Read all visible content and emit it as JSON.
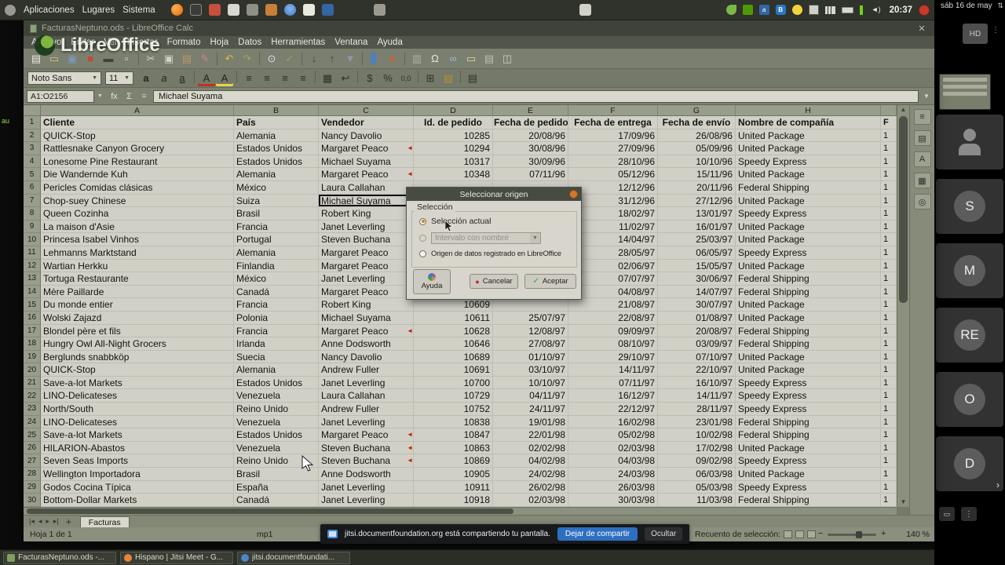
{
  "panel": {
    "menus": [
      "Aplicaciones",
      "Lugares",
      "Sistema"
    ],
    "launchers": [
      {
        "n": "firefox"
      },
      {
        "n": "terminal"
      },
      {
        "n": "mail"
      },
      {
        "n": "editor"
      },
      {
        "n": "files"
      },
      {
        "n": "music"
      },
      {
        "n": "chromium"
      },
      {
        "n": "document"
      },
      {
        "n": "maxima"
      },
      {
        "n": "screenshot"
      },
      {
        "n": "windowlist"
      }
    ],
    "tray": [
      {
        "n": "messaging",
        "cls": "tr-leaf"
      },
      {
        "n": "sync",
        "cls": "tr-box"
      },
      {
        "n": "input-method",
        "cls": "tr-app",
        "g": "a"
      },
      {
        "n": "bluetooth",
        "cls": "tr-bt",
        "g": "B"
      },
      {
        "n": "updates",
        "cls": "tr-update"
      },
      {
        "n": "display",
        "cls": "tr-display"
      },
      {
        "n": "network-signal",
        "cls": "tr-signal"
      },
      {
        "n": "battery",
        "cls": "tr-batt"
      },
      {
        "n": "power-indicator",
        "cls": "tr-ind"
      },
      {
        "n": "volume",
        "cls": "tr-vol",
        "g": "◄)"
      }
    ],
    "clock": "20:37"
  },
  "desktop": {
    "icon_label": "au"
  },
  "window": {
    "title": "FacturasNeptuno.ods - LibreOffice Calc"
  },
  "watermark": {
    "text": "LibreOffice"
  },
  "menubar": {
    "items": [
      "Archivo",
      "Editar",
      "Ver",
      "Insertar",
      "Formato",
      "Hoja",
      "Datos",
      "Herramientas",
      "Ventana",
      "Ayuda"
    ]
  },
  "toolbar_main": [
    {
      "n": "new",
      "g": "▤",
      "c": "#e8e8dc"
    },
    {
      "n": "open",
      "g": "▭",
      "c": "#d9c27e"
    },
    {
      "n": "save",
      "g": "▣",
      "c": "#7e96bb"
    },
    {
      "n": "export-pdf",
      "g": "■",
      "c": "#bf4a3a"
    },
    {
      "n": "print",
      "g": "▬",
      "c": "#3f443c"
    },
    {
      "n": "print-preview",
      "g": "▫",
      "c": "#dfe3d8"
    },
    {
      "sep": true
    },
    {
      "n": "cut",
      "g": "✂",
      "c": "#d6d6cb"
    },
    {
      "n": "copy",
      "g": "▣",
      "c": "#cfd2c5"
    },
    {
      "n": "paste",
      "g": "▤",
      "c": "#bb9a64"
    },
    {
      "n": "clone-formatting",
      "g": "✎",
      "c": "#cb8490"
    },
    {
      "sep": true
    },
    {
      "n": "undo",
      "g": "↶",
      "c": "#e6bb3e"
    },
    {
      "n": "redo",
      "g": "↷",
      "c": "#8cb64e"
    },
    {
      "sep": true
    },
    {
      "n": "find-replace",
      "g": "⊙",
      "c": "#d7dfe8"
    },
    {
      "n": "spelling",
      "g": "✓",
      "c": "#86b25c"
    },
    {
      "sep": true
    },
    {
      "n": "sort-ascending",
      "g": "↓",
      "c": "#3e423a"
    },
    {
      "n": "sort-descending",
      "g": "↑",
      "c": "#3e423a"
    },
    {
      "n": "autofilter",
      "g": "▼",
      "c": "#8e98ab"
    },
    {
      "sep": true
    },
    {
      "n": "insert-chart",
      "g": "▊",
      "c": "#5280b4"
    },
    {
      "n": "insert-image",
      "g": "●",
      "c": "#dd5a2a"
    },
    {
      "sep": true
    },
    {
      "n": "freeze-rows-columns",
      "g": "▥",
      "c": "#aeb6a2"
    },
    {
      "n": "special-character",
      "g": "Ω",
      "c": "#e8e8dd"
    },
    {
      "n": "hyperlink",
      "g": "∞",
      "c": "#9ab8d6"
    },
    {
      "n": "comment",
      "g": "▭",
      "c": "#e5dc96"
    },
    {
      "n": "headers-footers",
      "g": "▤",
      "c": "#b9c2b4"
    },
    {
      "n": "sidebar-toggle",
      "g": "◫",
      "c": "#ccd4c6"
    }
  ],
  "toolbar_format": {
    "font_name": "Noto Sans",
    "font_size": "11",
    "icons": [
      {
        "n": "bold",
        "g": "a",
        "cls": "fb"
      },
      {
        "n": "italic",
        "g": "a",
        "cls": "fi"
      },
      {
        "n": "underline",
        "g": "a",
        "cls": "fu"
      },
      {
        "sep": true
      },
      {
        "n": "font-color",
        "g": "A",
        "cls": "fc"
      },
      {
        "n": "highlight-color",
        "g": "A",
        "cls": "fh"
      },
      {
        "sep": true
      },
      {
        "n": "align-left",
        "g": "≡",
        "cls": "al"
      },
      {
        "n": "align-center",
        "g": "≡",
        "cls": "al"
      },
      {
        "n": "align-right",
        "g": "≡",
        "cls": "al"
      },
      {
        "n": "justify",
        "g": "≡",
        "cls": "al"
      },
      {
        "sep": true
      },
      {
        "n": "merge-cells",
        "g": "▦",
        "c": "#2e3228"
      },
      {
        "n": "wrap-text",
        "g": "↩",
        "c": "#2e3228"
      },
      {
        "sep": true
      },
      {
        "n": "format-currency",
        "g": "$",
        "c": "#2e3228"
      },
      {
        "n": "format-percent",
        "g": "%",
        "c": "#2e3228"
      },
      {
        "n": "format-number",
        "g": "0,0",
        "c": "#2e3228"
      },
      {
        "sep": true
      },
      {
        "n": "borders",
        "g": "⊞",
        "c": "#2e3228"
      },
      {
        "n": "background-color",
        "g": "▨",
        "c": "#b58a3c"
      },
      {
        "sep": true
      },
      {
        "n": "conditional-formatting",
        "g": "▤",
        "c": "#2e3228"
      }
    ]
  },
  "formula_bar": {
    "name_box": "A1:O2156",
    "fx_label": "fx",
    "sum_label": "Σ",
    "equals_label": "=",
    "content": "Michael Suyama"
  },
  "grid": {
    "col_letters": [
      "A",
      "B",
      "C",
      "D",
      "E",
      "F",
      "G",
      "H"
    ],
    "rows": [
      {
        "n": "1",
        "h": true,
        "c": [
          "Cliente",
          "País",
          "Vendedor",
          "Id. de pedido",
          "Fecha de pedido",
          "Fecha de entrega",
          "Fecha de envío",
          "Nombre de compañía",
          "F"
        ]
      },
      {
        "n": "2",
        "c": [
          "QUICK-Stop",
          "Alemania",
          "Nancy Davolio",
          "10285",
          "20/08/96",
          "17/09/96",
          "26/08/96",
          "United Package",
          "1"
        ]
      },
      {
        "n": "3",
        "t": 1,
        "c": [
          "Rattlesnake Canyon Grocery",
          "Estados Unidos",
          "Margaret Peaco",
          "10294",
          "30/08/96",
          "27/09/96",
          "05/09/96",
          "United Package",
          "1"
        ]
      },
      {
        "n": "4",
        "c": [
          "Lonesome Pine Restaurant",
          "Estados Unidos",
          "Michael Suyama",
          "10317",
          "30/09/96",
          "28/10/96",
          "10/10/96",
          "Speedy Express",
          "1"
        ]
      },
      {
        "n": "5",
        "t": 1,
        "c": [
          "Die Wandernde Kuh",
          "Alemania",
          "Margaret Peaco",
          "10348",
          "07/11/96",
          "05/12/96",
          "15/11/96",
          "United Package",
          "1"
        ]
      },
      {
        "n": "6",
        "c": [
          "Pericles Comidas clásicas",
          "México",
          "Laura Callahan",
          "",
          "",
          "12/12/96",
          "20/11/96",
          "Federal Shipping",
          "1"
        ]
      },
      {
        "n": "7",
        "a": 1,
        "c": [
          "Chop-suey Chinese",
          "Suiza",
          "Michael Suyama",
          "",
          "",
          "31/12/96",
          "27/12/96",
          "United Package",
          "1"
        ]
      },
      {
        "n": "8",
        "c": [
          "Queen Cozinha",
          "Brasil",
          "Robert King",
          "",
          "",
          "18/02/97",
          "13/01/97",
          "Speedy Express",
          "1"
        ]
      },
      {
        "n": "9",
        "c": [
          "La maison d'Asie",
          "Francia",
          "Janet Leverling",
          "",
          "",
          "11/02/97",
          "16/01/97",
          "United Package",
          "1"
        ]
      },
      {
        "n": "10",
        "t": 1,
        "c": [
          "Princesa Isabel Vinhos",
          "Portugal",
          "Steven Buchana",
          "",
          "",
          "14/04/97",
          "25/03/97",
          "United Package",
          "1"
        ]
      },
      {
        "n": "11",
        "t": 1,
        "c": [
          "Lehmanns Marktstand",
          "Alemania",
          "Margaret Peaco",
          "",
          "",
          "28/05/97",
          "06/05/97",
          "Speedy Express",
          "1"
        ]
      },
      {
        "n": "12",
        "t": 1,
        "c": [
          "Wartian Herkku",
          "Finlandia",
          "Margaret Peaco",
          "",
          "",
          "02/06/97",
          "15/05/97",
          "United Package",
          "1"
        ]
      },
      {
        "n": "13",
        "c": [
          "Tortuga Restaurante",
          "México",
          "Janet Leverling",
          "",
          "",
          "07/07/97",
          "30/06/97",
          "Federal Shipping",
          "1"
        ]
      },
      {
        "n": "14",
        "t": 1,
        "c": [
          "Mère Paillarde",
          "Canadá",
          "Margaret Peaco",
          "",
          "",
          "04/08/97",
          "14/07/97",
          "Federal Shipping",
          "1"
        ]
      },
      {
        "n": "15",
        "c": [
          "Du monde entier",
          "Francia",
          "Robert King",
          "10609",
          "",
          "21/08/97",
          "30/07/97",
          "United Package",
          "1"
        ]
      },
      {
        "n": "16",
        "c": [
          "Wolski Zajazd",
          "Polonia",
          "Michael Suyama",
          "10611",
          "25/07/97",
          "22/08/97",
          "01/08/97",
          "United Package",
          "1"
        ]
      },
      {
        "n": "17",
        "t": 1,
        "c": [
          "Blondel père et fils",
          "Francia",
          "Margaret Peaco",
          "10628",
          "12/08/97",
          "09/09/97",
          "20/08/97",
          "Federal Shipping",
          "1"
        ]
      },
      {
        "n": "18",
        "c": [
          "Hungry Owl All-Night Grocers",
          "Irlanda",
          "Anne Dodsworth",
          "10646",
          "27/08/97",
          "08/10/97",
          "03/09/97",
          "Federal Shipping",
          "1"
        ]
      },
      {
        "n": "19",
        "c": [
          "Berglunds snabbköp",
          "Suecia",
          "Nancy Davolio",
          "10689",
          "01/10/97",
          "29/10/97",
          "07/10/97",
          "United Package",
          "1"
        ]
      },
      {
        "n": "20",
        "c": [
          "QUICK-Stop",
          "Alemania",
          "Andrew Fuller",
          "10691",
          "03/10/97",
          "14/11/97",
          "22/10/97",
          "United Package",
          "1"
        ]
      },
      {
        "n": "21",
        "c": [
          "Save-a-lot Markets",
          "Estados Unidos",
          "Janet Leverling",
          "10700",
          "10/10/97",
          "07/11/97",
          "16/10/97",
          "Speedy Express",
          "1"
        ]
      },
      {
        "n": "22",
        "c": [
          "LINO-Delicateses",
          "Venezuela",
          "Laura Callahan",
          "10729",
          "04/11/97",
          "16/12/97",
          "14/11/97",
          "Speedy Express",
          "1"
        ]
      },
      {
        "n": "23",
        "c": [
          "North/South",
          "Reino Unido",
          "Andrew Fuller",
          "10752",
          "24/11/97",
          "22/12/97",
          "28/11/97",
          "Speedy Express",
          "1"
        ]
      },
      {
        "n": "24",
        "c": [
          "LINO-Delicateses",
          "Venezuela",
          "Janet Leverling",
          "10838",
          "19/01/98",
          "16/02/98",
          "23/01/98",
          "Federal Shipping",
          "1"
        ]
      },
      {
        "n": "25",
        "t": 1,
        "c": [
          "Save-a-lot Markets",
          "Estados Unidos",
          "Margaret Peaco",
          "10847",
          "22/01/98",
          "05/02/98",
          "10/02/98",
          "Federal Shipping",
          "1"
        ]
      },
      {
        "n": "26",
        "t": 1,
        "c": [
          "HILARION-Abastos",
          "Venezuela",
          "Steven Buchana",
          "10863",
          "02/02/98",
          "02/03/98",
          "17/02/98",
          "United Package",
          "1"
        ]
      },
      {
        "n": "27",
        "t": 1,
        "c": [
          "Seven Seas Imports",
          "Reino Unido",
          "Steven Buchana",
          "10869",
          "04/02/98",
          "04/03/98",
          "09/02/98",
          "Speedy Express",
          "1"
        ]
      },
      {
        "n": "28",
        "c": [
          "Wellington Importadora",
          "Brasil",
          "Anne Dodsworth",
          "10905",
          "24/02/98",
          "24/03/98",
          "06/03/98",
          "United Package",
          "1"
        ]
      },
      {
        "n": "29",
        "c": [
          "Godos Cocina Típica",
          "España",
          "Janet Leverling",
          "10911",
          "26/02/98",
          "26/03/98",
          "05/03/98",
          "Speedy Express",
          "1"
        ]
      },
      {
        "n": "30",
        "c": [
          "Bottom-Dollar Markets",
          "Canadá",
          "Janet Leverling",
          "10918",
          "02/03/98",
          "30/03/98",
          "11/03/98",
          "Federal Shipping",
          "1"
        ]
      }
    ]
  },
  "sheet_tabs": {
    "nav": [
      {
        "n": "first-sheet",
        "g": "|◂"
      },
      {
        "n": "previous-sheet",
        "g": "◂"
      },
      {
        "n": "next-sheet",
        "g": "▸"
      },
      {
        "n": "last-sheet",
        "g": "▸|"
      }
    ],
    "add": "+",
    "name": "Facturas"
  },
  "side_tabs": [
    {
      "n": "sidebar-menu",
      "g": "≡"
    },
    {
      "n": "properties-deck",
      "g": "▤"
    },
    {
      "n": "styles-deck",
      "g": "A"
    },
    {
      "n": "gallery-deck",
      "g": "▦"
    },
    {
      "n": "navigator-deck",
      "g": "◎"
    }
  ],
  "statusbar": {
    "sheet_info": "Hoja 1 de 1",
    "page_style": "mp1",
    "selection_info": "Recuento de selección: 1",
    "zoom_out": "−",
    "zoom_in": "+",
    "zoom_level": "140 %"
  },
  "dialog": {
    "title": "Seleccionar origen",
    "section": "Selección",
    "option_current": "Selección actual",
    "combo_value": "Intervalo con nombre",
    "option_registered": "Origen de datos registrado en LibreOffice",
    "help_label": "Ayuda",
    "cancel_label": "Cancelar",
    "ok_label": "Aceptar"
  },
  "notification": {
    "message": "jitsi.documentfoundation.org está compartiendo tu pantalla.",
    "stop_label": "Dejar de compartir",
    "hide_label": "Ocultar"
  },
  "taskbar": {
    "items": [
      {
        "n": "task-calc",
        "label": "FacturasNeptuno.ods -..."
      },
      {
        "n": "task-jitsi",
        "label": "Hispano | Jitsi Meet - G..."
      },
      {
        "n": "task-browser",
        "label": "jitsi.documentfoundati..."
      }
    ]
  },
  "participants": {
    "date": "sáb 16 de may",
    "self_label": "HD",
    "tiles": [
      {
        "k": "person"
      },
      {
        "k": "i",
        "t": "S"
      },
      {
        "k": "i",
        "t": "M"
      },
      {
        "k": "i",
        "t": "RE"
      },
      {
        "k": "i",
        "t": "O"
      },
      {
        "k": "i",
        "t": "D"
      }
    ]
  }
}
